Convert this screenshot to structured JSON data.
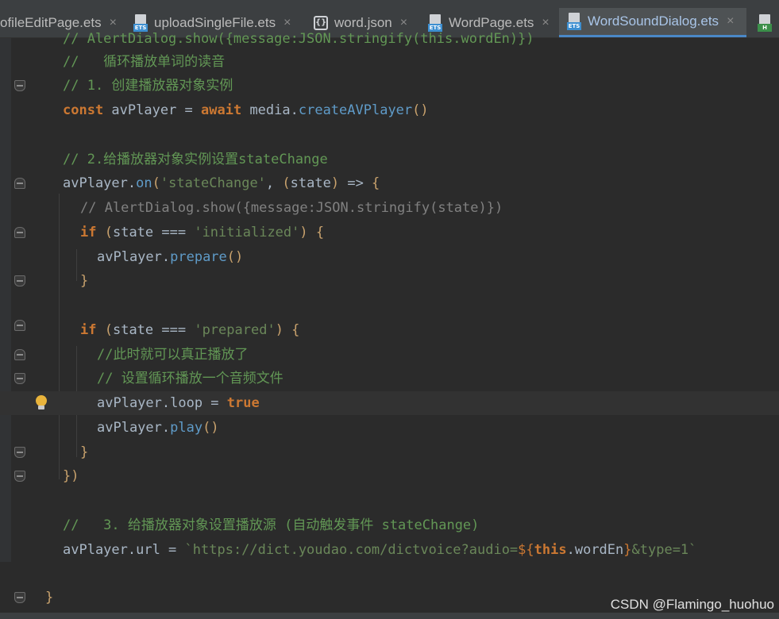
{
  "tabs": [
    {
      "label": "ofileEditPage.ets",
      "icon": "ets-file-icon",
      "active": false
    },
    {
      "label": "uploadSingleFile.ets",
      "icon": "ets-file-icon",
      "active": false
    },
    {
      "label": "word.json",
      "icon": "json-file-icon",
      "active": false
    },
    {
      "label": "WordPage.ets",
      "icon": "ets-file-icon",
      "active": false
    },
    {
      "label": "WordSoundDialog.ets",
      "icon": "ets-file-icon",
      "active": true
    },
    {
      "label": "",
      "icon": "html-file-icon",
      "active": false
    }
  ],
  "close_glyph": "×",
  "icon_badges": {
    "ets": "ETS",
    "json": "{}",
    "html": "H"
  },
  "code": {
    "l0": "// AlertDialog.show({message:JSON.stringify(this.wordEn)})",
    "l1": "//   循环播放单词的读音",
    "l2": "// 1. 创建播放器对象实例",
    "l3_kw": "const",
    "l3_a": " avPlayer = ",
    "l3_kw2": "await",
    "l3_b": " media.",
    "l3_fn": "createAVPlayer",
    "l3_p": "()",
    "l5": "// 2.给播放器对象实例设置stateChange",
    "l6_a": "avPlayer.",
    "l6_fn": "on",
    "l6_p1": "(",
    "l6_str": "'stateChange'",
    "l6_b": ", ",
    "l6_p2": "(",
    "l6_c": "state",
    "l6_p3": ")",
    "l6_d": " => ",
    "l6_br": "{",
    "l7": "// AlertDialog.show({message:JSON.stringify(state)})",
    "l8_kw": "if",
    "l8_p1": " (",
    "l8_a": "state === ",
    "l8_str": "'initialized'",
    "l8_p2": ")",
    "l8_br": " {",
    "l9_a": "avPlayer.",
    "l9_fn": "prepare",
    "l9_p": "()",
    "l10": "}",
    "l12_kw": "if",
    "l12_p1": " (",
    "l12_a": "state === ",
    "l12_str": "'prepared'",
    "l12_p2": ")",
    "l12_br": " {",
    "l13": "//此时就可以真正播放了",
    "l14": "// 设置循环播放一个音频文件",
    "l15_a": "avPlayer.loop = ",
    "l15_kw": "true",
    "l16_a": "avPlayer.",
    "l16_fn": "play",
    "l16_p": "()",
    "l17": "}",
    "l18_br": "}",
    "l18_p": ")",
    "l20": "//   3. 给播放器对象设置播放源 (自动触发事件 stateChange)",
    "l21_a": "avPlayer.url = ",
    "l21_str": "`https://dict.youdao.com/dictvoice?audio=",
    "l21_t1": "${",
    "l21_kw": "this",
    "l21_b": ".wordEn",
    "l21_t2": "}",
    "l21_str2": "&type=1`",
    "l23": "}"
  },
  "watermark": "CSDN @Flamingo_huohuo",
  "colors": {
    "background": "#2b2b2b",
    "keyword": "#cc7832",
    "string": "#6a8759",
    "comment": "#629755",
    "function": "#5f9bc8",
    "active_tab_underline": "#4a88c7"
  }
}
